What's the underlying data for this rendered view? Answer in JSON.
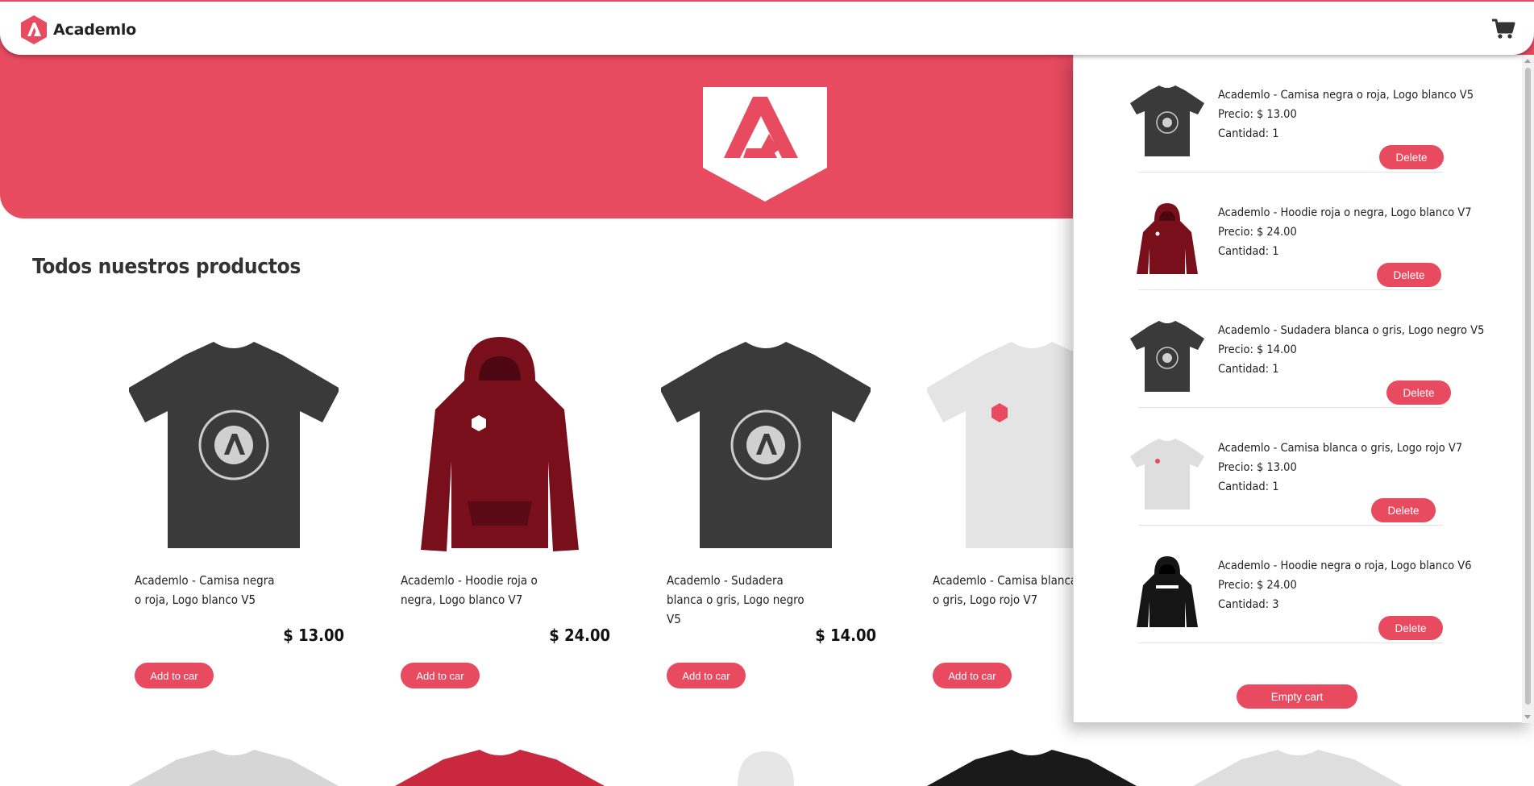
{
  "nav": {
    "brand": "Academlo",
    "cart_icon": "cart-icon"
  },
  "colors": {
    "accent": "#e84a5f",
    "tshirt_dark": "#3a3a3a",
    "hoodie_red": "#7a0f1c",
    "light_gray": "#d6d6d6"
  },
  "main": {
    "title": "Todos nuestros productos"
  },
  "products": [
    {
      "name": "Academlo - Camisa negra o roja, Logo blanco V5",
      "price": "$ 13.00",
      "button": "Add to car"
    },
    {
      "name": "Academlo - Hoodie roja o negra, Logo blanco V7",
      "price": "$ 24.00",
      "button": "Add to car"
    },
    {
      "name": "Academlo - Sudadera blanca o gris, Logo negro V5",
      "price": "$ 14.00",
      "button": "Add to car"
    },
    {
      "name": "Academlo - Camisa blanca o gris, Logo rojo V7",
      "price": "",
      "button": "Add to car"
    }
  ],
  "cart": {
    "items": [
      {
        "name": "Academlo - Camisa negra o roja, Logo blanco V5",
        "price": "Precio: $ 13.00",
        "qty": "Cantidad: 1",
        "button": "Delete"
      },
      {
        "name": "Academlo - Hoodie roja o negra, Logo blanco V7",
        "price": "Precio: $ 24.00",
        "qty": "Cantidad: 1",
        "button": "Delete"
      },
      {
        "name": "Academlo - Sudadera blanca o gris, Logo negro V5",
        "price": "Precio: $ 14.00",
        "qty": "Cantidad: 1",
        "button": "Delete"
      },
      {
        "name": "Academlo - Camisa blanca o gris, Logo rojo V7",
        "price": "Precio: $ 13.00",
        "qty": "Cantidad: 1",
        "button": "Delete"
      },
      {
        "name": "Academlo - Hoodie negra o roja, Logo blanco V6",
        "price": "Precio: $ 24.00",
        "qty": "Cantidad: 3",
        "button": "Delete"
      }
    ],
    "empty_button": "Empty cart"
  }
}
